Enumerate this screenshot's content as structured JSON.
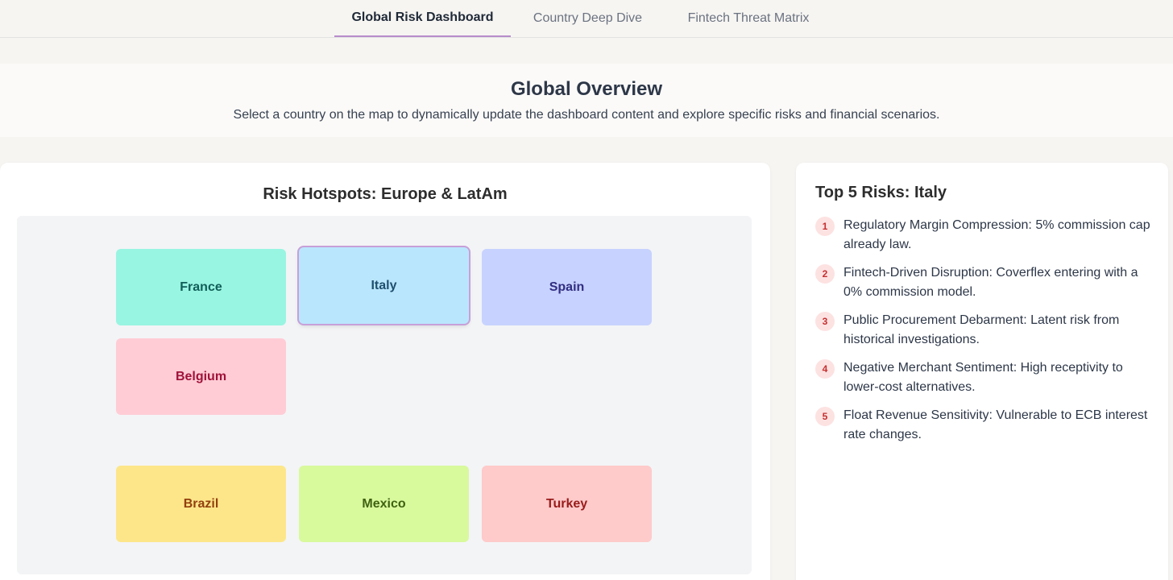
{
  "nav": {
    "tabs": [
      {
        "label": "Global Risk Dashboard",
        "active": true
      },
      {
        "label": "Country Deep Dive",
        "active": false
      },
      {
        "label": "Fintech Threat Matrix",
        "active": false
      }
    ]
  },
  "overview": {
    "title": "Global Overview",
    "description": "Select a country on the map to dynamically update the dashboard content and explore specific risks and financial scenarios."
  },
  "map": {
    "title": "Risk Hotspots: Europe & LatAm",
    "countries": [
      {
        "label": "France",
        "bg": "#98f5e1",
        "fg": "#115e59"
      },
      {
        "label": "Italy",
        "bg": "#bae6fd",
        "fg": "#1e4f6e",
        "selected": true
      },
      {
        "label": "Spain",
        "bg": "#c7d2fe",
        "fg": "#312e81"
      },
      {
        "label": "Belgium",
        "bg": "#ffccd5",
        "fg": "#9f1239"
      },
      {
        "label": "Brazil",
        "bg": "#fde68a",
        "fg": "#92400e"
      },
      {
        "label": "Mexico",
        "bg": "#d9f99d",
        "fg": "#3f6212"
      },
      {
        "label": "Turkey",
        "bg": "#fecaca",
        "fg": "#991b1b"
      }
    ]
  },
  "risks": {
    "title": "Top 5 Risks: Italy",
    "items": [
      {
        "num": "1",
        "text": "Regulatory Margin Compression: 5% commission cap already law."
      },
      {
        "num": "2",
        "text": "Fintech-Driven Disruption: Coverflex entering with a 0% commission model."
      },
      {
        "num": "3",
        "text": "Public Procurement Debarment: Latent risk from historical investigations."
      },
      {
        "num": "4",
        "text": "Negative Merchant Sentiment: High receptivity to lower-cost alternatives."
      },
      {
        "num": "5",
        "text": "Float Revenue Sensitivity: Vulnerable to ECB interest rate changes."
      }
    ]
  }
}
